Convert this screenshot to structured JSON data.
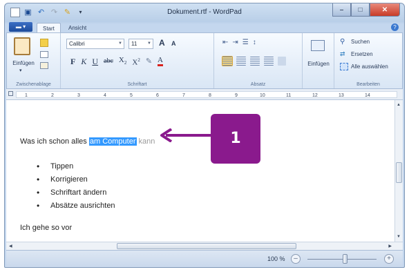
{
  "window": {
    "title": "Dokument.rtf - WordPad"
  },
  "title_buttons": {
    "minimize": "–",
    "maximize": "□",
    "close": "✕"
  },
  "quick_access": {
    "icons": [
      "app-icon",
      "save-icon",
      "undo-icon",
      "redo-icon",
      "print-icon"
    ],
    "dropdown": "▾"
  },
  "tabs": {
    "menu": "▬ ▾",
    "start": "Start",
    "view": "Ansicht",
    "help": "?"
  },
  "ribbon": {
    "clipboard": {
      "paste": "Einfügen",
      "group": "Zwischenablage"
    },
    "font": {
      "family": "Calibri",
      "size": "11",
      "grow": "A",
      "shrink": "A",
      "bold": "F",
      "italic": "K",
      "underline": "U",
      "strike": "abc",
      "subscript": "X",
      "superscript": "X",
      "group": "Schriftart"
    },
    "paragraph": {
      "group": "Absatz"
    },
    "insert": {
      "label": "Einfügen"
    },
    "editing": {
      "find": "Suchen",
      "replace": "Ersetzen",
      "select_all": "Alle auswählen",
      "group": "Bearbeiten"
    }
  },
  "ruler": {
    "marks": [
      "1",
      "2",
      "3",
      "4",
      "5",
      "6",
      "7",
      "8",
      "9",
      "10",
      "11",
      "12",
      "13",
      "14"
    ]
  },
  "document": {
    "line1_before": "Was ich schon alles ",
    "line1_selected": "am Computer",
    "line1_after": " kann",
    "bullets": [
      "Tippen",
      "Korrigieren",
      "Schriftart ändern",
      "Absätze ausrichten"
    ],
    "line2": "Ich gehe so vor"
  },
  "statusbar": {
    "zoom": "100 %",
    "zoom_out": "–",
    "zoom_in": "+",
    "zoom_level": 0.5
  },
  "annotation": {
    "number": "1",
    "color": "#8a1a8d"
  }
}
